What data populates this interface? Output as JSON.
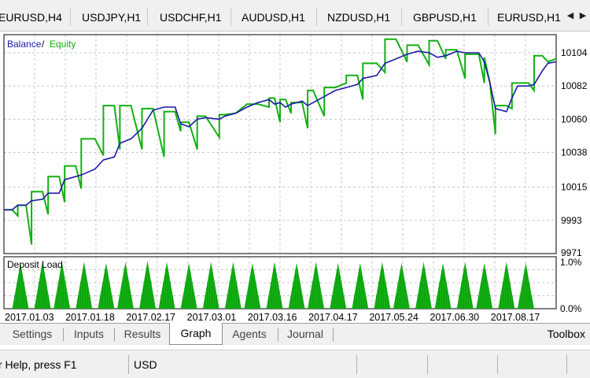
{
  "symbol_tabs": [
    "EURUSD,H4",
    "USDJPY,H1",
    "USDCHF,H1",
    "AUDUSD,H1",
    "NZDUSD,H1",
    "GBPUSD,H1",
    "EURUSD,H1"
  ],
  "nav_icons": [
    "arrow-left-icon",
    "arrow-right-icon"
  ],
  "legend": {
    "balance": "Balance",
    "separator": "/",
    "equity": "Equity"
  },
  "colors": {
    "balance": "#1a1aa8",
    "equity": "#12b012",
    "deposit_load": "#12b012",
    "grid": "#c8c8c8"
  },
  "deposit_panel": {
    "label": "Deposit Load",
    "scale_top": "1.0%",
    "scale_bottom": "0.0%"
  },
  "chart_data": {
    "type": "line",
    "series": [
      {
        "name": "Balance",
        "points": [
          [
            0,
            10000
          ],
          [
            3,
            10000
          ],
          [
            5,
            10003
          ],
          [
            8,
            10003
          ],
          [
            10,
            10006
          ],
          [
            14,
            10007
          ],
          [
            16,
            10011
          ],
          [
            20,
            10011
          ],
          [
            22,
            10020
          ],
          [
            26,
            10022
          ],
          [
            28,
            10023
          ],
          [
            33,
            10027
          ],
          [
            36,
            10033
          ],
          [
            40,
            10035
          ],
          [
            42,
            10044
          ],
          [
            46,
            10047
          ],
          [
            50,
            10054
          ],
          [
            54,
            10066
          ],
          [
            58,
            10068
          ],
          [
            62,
            10068
          ],
          [
            64,
            10057
          ],
          [
            67,
            10055
          ],
          [
            70,
            10060
          ],
          [
            73,
            10061
          ],
          [
            78,
            10060
          ],
          [
            80,
            10062
          ],
          [
            84,
            10064
          ],
          [
            88,
            10068
          ],
          [
            92,
            10071
          ],
          [
            96,
            10073
          ],
          [
            98,
            10070
          ],
          [
            100,
            10071
          ],
          [
            102,
            10068
          ],
          [
            104,
            10070
          ],
          [
            108,
            10072
          ],
          [
            110,
            10069
          ],
          [
            112,
            10071
          ],
          [
            116,
            10075
          ],
          [
            120,
            10079
          ],
          [
            124,
            10081
          ],
          [
            128,
            10083
          ],
          [
            130,
            10087
          ],
          [
            135,
            10089
          ],
          [
            138,
            10097
          ],
          [
            142,
            10100
          ],
          [
            146,
            10103
          ],
          [
            150,
            10105
          ],
          [
            154,
            10104
          ],
          [
            157,
            10101
          ],
          [
            160,
            10102
          ],
          [
            164,
            10105
          ],
          [
            167,
            10104
          ],
          [
            172,
            10104
          ],
          [
            174,
            10098
          ],
          [
            176,
            10084
          ],
          [
            178,
            10067
          ],
          [
            182,
            10065
          ],
          [
            184,
            10074
          ],
          [
            186,
            10082
          ],
          [
            190,
            10082
          ],
          [
            192,
            10083
          ],
          [
            195,
            10092
          ],
          [
            197,
            10097
          ],
          [
            200,
            10098
          ]
        ]
      },
      {
        "name": "Equity",
        "points": [
          [
            0,
            10000
          ],
          [
            3,
            10000
          ],
          [
            5,
            9996
          ],
          [
            5,
            10003
          ],
          [
            8,
            10003
          ],
          [
            10,
            9977
          ],
          [
            10,
            10012
          ],
          [
            14,
            10012
          ],
          [
            16,
            9997
          ],
          [
            16,
            10022
          ],
          [
            20,
            10022
          ],
          [
            22,
            10005
          ],
          [
            22,
            10029
          ],
          [
            26,
            10029
          ],
          [
            28,
            10014
          ],
          [
            28,
            10047
          ],
          [
            33,
            10047
          ],
          [
            36,
            10036
          ],
          [
            36,
            10069
          ],
          [
            40,
            10069
          ],
          [
            42,
            10040
          ],
          [
            42,
            10069
          ],
          [
            46,
            10069
          ],
          [
            50,
            10040
          ],
          [
            50,
            10067
          ],
          [
            54,
            10067
          ],
          [
            58,
            10035
          ],
          [
            58,
            10065
          ],
          [
            62,
            10065
          ],
          [
            64,
            10052
          ],
          [
            64,
            10058
          ],
          [
            67,
            10058
          ],
          [
            70,
            10040
          ],
          [
            70,
            10062
          ],
          [
            73,
            10062
          ],
          [
            78,
            10048
          ],
          [
            78,
            10063
          ],
          [
            80,
            10063
          ],
          [
            84,
            10064
          ],
          [
            88,
            10070
          ],
          [
            92,
            10070
          ],
          [
            96,
            10068
          ],
          [
            96,
            10074
          ],
          [
            98,
            10074
          ],
          [
            100,
            10058
          ],
          [
            100,
            10073
          ],
          [
            102,
            10073
          ],
          [
            104,
            10064
          ],
          [
            104,
            10071
          ],
          [
            108,
            10071
          ],
          [
            110,
            10054
          ],
          [
            110,
            10079
          ],
          [
            112,
            10079
          ],
          [
            116,
            10062
          ],
          [
            116,
            10081
          ],
          [
            120,
            10081
          ],
          [
            124,
            10084
          ],
          [
            124,
            10089
          ],
          [
            128,
            10089
          ],
          [
            130,
            10073
          ],
          [
            130,
            10097
          ],
          [
            135,
            10097
          ],
          [
            138,
            10091
          ],
          [
            138,
            10113
          ],
          [
            142,
            10113
          ],
          [
            146,
            10098
          ],
          [
            146,
            10109
          ],
          [
            150,
            10109
          ],
          [
            154,
            10096
          ],
          [
            154,
            10112
          ],
          [
            157,
            10112
          ],
          [
            160,
            10100
          ],
          [
            160,
            10106
          ],
          [
            164,
            10106
          ],
          [
            167,
            10087
          ],
          [
            167,
            10103
          ],
          [
            172,
            10103
          ],
          [
            174,
            10084
          ],
          [
            174,
            10101
          ],
          [
            176,
            10084
          ],
          [
            178,
            10050
          ],
          [
            178,
            10069
          ],
          [
            182,
            10069
          ],
          [
            184,
            10067
          ],
          [
            184,
            10084
          ],
          [
            186,
            10084
          ],
          [
            190,
            10084
          ],
          [
            192,
            10079
          ],
          [
            192,
            10102
          ],
          [
            195,
            10102
          ],
          [
            197,
            10098
          ],
          [
            200,
            10100
          ]
        ]
      }
    ],
    "y_ticks": [
      "10104",
      "10082",
      "10060",
      "10038",
      "10015",
      "9993",
      "9971"
    ],
    "y_tick_values": [
      10104,
      10082,
      10060,
      10038,
      10015,
      9993,
      9971
    ],
    "ylim": [
      9971,
      10116
    ],
    "xlim": [
      0,
      200
    ],
    "x_ticks": [
      "2017.01.03",
      "2017.01.18",
      "2017.02.17",
      "2017.03.01",
      "2017.03.16",
      "2017.04.17",
      "2017.05.24",
      "2017.06.30",
      "2017.08.17"
    ],
    "x_tick_positions": [
      0,
      22,
      44,
      66,
      88,
      110,
      132,
      154,
      176
    ],
    "grid": true,
    "deposit_load": {
      "type": "area",
      "ylim": [
        0,
        1.0
      ],
      "unit": "%",
      "peaks": [
        [
          6,
          0.88
        ],
        [
          14,
          0.92
        ],
        [
          21,
          0.9
        ],
        [
          29,
          0.9
        ],
        [
          37,
          0.88
        ],
        [
          44,
          0.9
        ],
        [
          52,
          0.92
        ],
        [
          59,
          0.9
        ],
        [
          67,
          0.88
        ],
        [
          75,
          0.9
        ],
        [
          83,
          0.9
        ],
        [
          90,
          0.88
        ],
        [
          98,
          0.9
        ],
        [
          106,
          0.88
        ],
        [
          113,
          0.9
        ],
        [
          121,
          0.88
        ],
        [
          129,
          0.88
        ],
        [
          137,
          0.9
        ],
        [
          144,
          0.88
        ],
        [
          152,
          0.9
        ],
        [
          159,
          0.88
        ],
        [
          167,
          0.9
        ],
        [
          174,
          0.88
        ],
        [
          182,
          0.9
        ],
        [
          189,
          0.88
        ]
      ]
    }
  },
  "bottom_tabs": [
    "Settings",
    "Inputs",
    "Results",
    "Graph",
    "Agents",
    "Journal"
  ],
  "active_tab": "Graph",
  "toolbox_label": "Toolbox",
  "status": {
    "help": "r Help, press F1",
    "currency": "USD"
  }
}
